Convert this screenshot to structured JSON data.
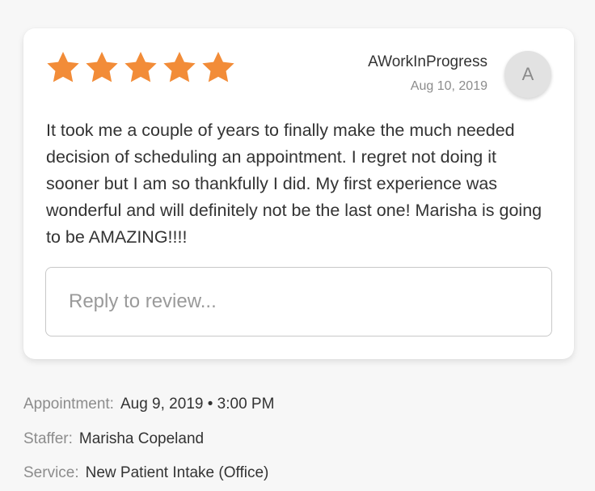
{
  "review": {
    "rating": 5,
    "max_rating": 5,
    "star_color": "#F28C38",
    "reviewer_name": "AWorkInProgress",
    "date": "Aug 10, 2019",
    "avatar_initial": "A",
    "text": "It took me a couple of years to finally make the much needed decision of scheduling an appointment. I regret not doing it sooner but I am so thankfully I did. My first experience was wonderful and will definitely not be the last one! Marisha is going to be AMAZING!!!!",
    "reply_placeholder": "Reply to review...",
    "reply_value": ""
  },
  "details": {
    "appointment_label": "Appointment:",
    "appointment_value": "Aug 9, 2019 • 3:00 PM",
    "staffer_label": "Staffer:",
    "staffer_value": "Marisha Copeland",
    "service_label": "Service:",
    "service_value": "New Patient Intake (Office)"
  }
}
